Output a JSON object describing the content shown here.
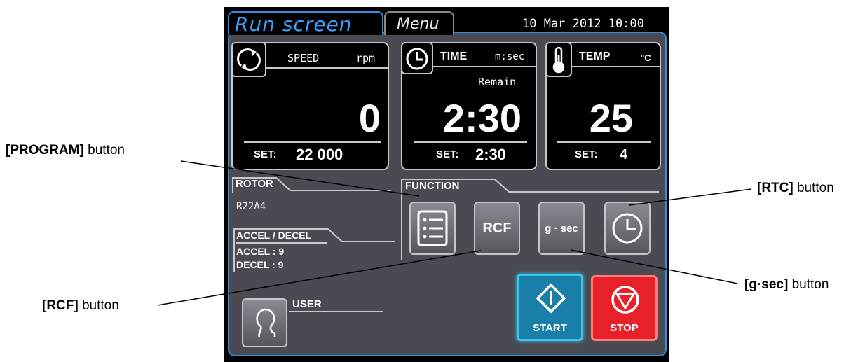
{
  "header": {
    "tab_run": "Run screen",
    "tab_menu": "Menu",
    "datetime": "10 Mar 2012 10:00"
  },
  "speed": {
    "label": "SPEED",
    "unit": "rpm",
    "value": "0",
    "set_label": "SET:",
    "set_value": "22 000",
    "icon": "rotation-icon"
  },
  "time": {
    "label": "TIME",
    "unit": "m:sec",
    "sub": "Remain",
    "value": "2:30",
    "set_label": "SET:",
    "set_value": "2:30",
    "icon": "clock-icon"
  },
  "temp": {
    "label": "TEMP",
    "unit": "°C",
    "value": "25",
    "set_label": "SET:",
    "set_value": "4",
    "icon": "thermometer-icon"
  },
  "rotor": {
    "title": "ROTOR",
    "value": "R22A4"
  },
  "accel_decel": {
    "title": "ACCEL / DECEL",
    "accel": "ACCEL : 9",
    "decel": "DECEL : 9"
  },
  "function": {
    "title": "FUNCTION",
    "buttons": [
      {
        "label": "",
        "icon": "program-list-icon"
      },
      {
        "label": "RCF"
      },
      {
        "label": "g · sec"
      },
      {
        "label": "",
        "icon": "rtc-clock-icon"
      }
    ]
  },
  "user": {
    "title": "USER",
    "icon": "user-icon"
  },
  "start": {
    "label": "START",
    "color": "#36c8f0"
  },
  "stop": {
    "label": "STOP",
    "color": "#e8202a"
  },
  "callouts": {
    "program": {
      "bold": "[PROGRAM]",
      "rest": " button"
    },
    "rcf": {
      "bold": "[RCF]",
      "rest": " button"
    },
    "rtc": {
      "bold": "[RTC]",
      "rest": " button"
    },
    "gsec": {
      "bold": "[g·sec]",
      "rest": " button"
    }
  }
}
